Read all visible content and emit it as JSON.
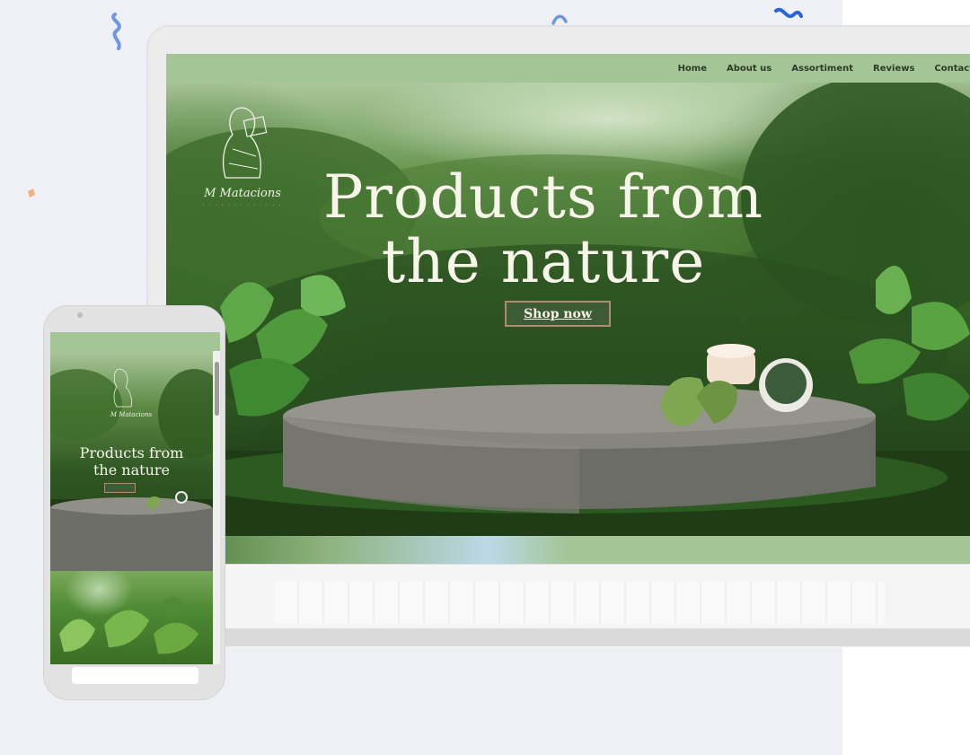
{
  "nav": {
    "items": [
      "Home",
      "About us",
      "Assortiment",
      "Reviews",
      "Contact"
    ]
  },
  "hero": {
    "brand": "M Matacions",
    "title_line1": "Products from",
    "title_line2": "the nature",
    "cta_label": "Shop now"
  },
  "mobile": {
    "brand": "M Matacions",
    "title_line1": "Products from",
    "title_line2": "the nature"
  },
  "colors": {
    "nav_green": "#a4c596",
    "button_green": "#3d5c35",
    "button_border": "#b08b72",
    "title_cream": "#f7f5ea",
    "page_bg": "#eef0f5"
  }
}
